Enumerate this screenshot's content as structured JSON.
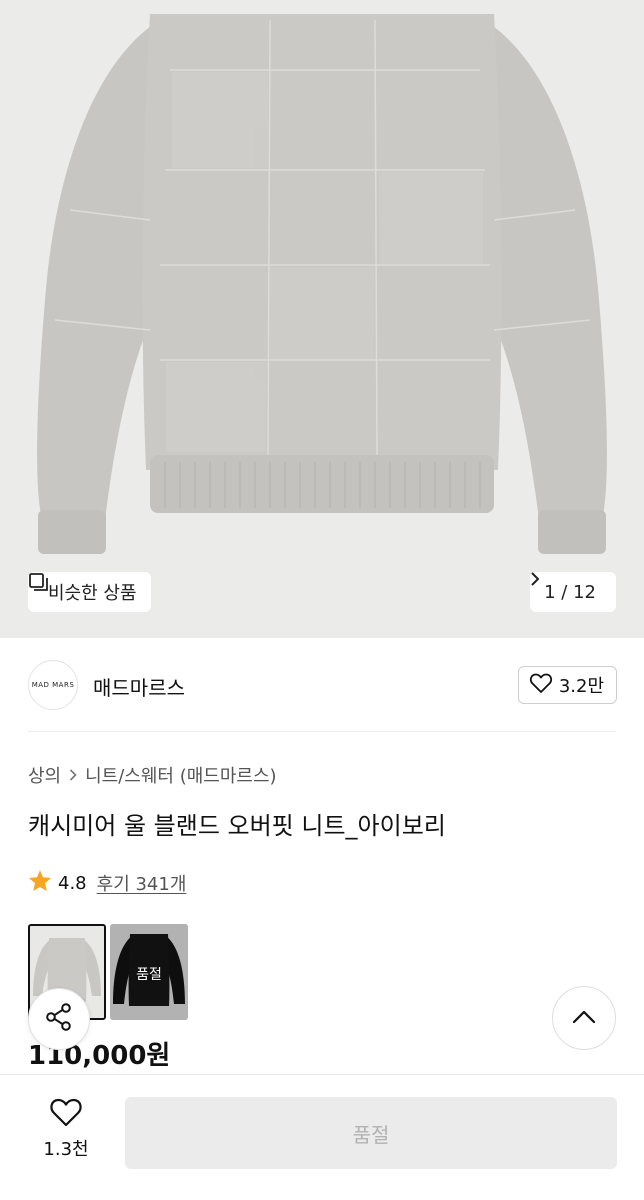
{
  "gallery": {
    "similar_label": "비슷한 상품",
    "counter": "1 / 12"
  },
  "brand": {
    "logo_text": "MAD  MARS",
    "name": "매드마르스",
    "likes": "3.2만"
  },
  "breadcrumb": {
    "category": "상의",
    "subcategory": "니트/스웨터 (매드마르스)"
  },
  "product": {
    "title": "캐시미어 울 블랜드 오버핏 니트_아이보리",
    "rating": "4.8",
    "reviews": "후기 341개",
    "price": "110,000원"
  },
  "swatches": [
    {
      "color": "ivory"
    },
    {
      "color": "black",
      "label": "품절"
    }
  ],
  "bottom_bar": {
    "wish_count": "1.3천",
    "buy_label": "품절"
  },
  "colors": {
    "star": "#f5a623",
    "sweater_ivory": "#c9c7c3",
    "sweater_black": "#121212",
    "disabled_button": "#ebebeb"
  },
  "icons": {
    "similar": "similar-products-icon",
    "next": "chevron-right-icon",
    "like": "heart-icon",
    "breadcrumb_separator": "chevron-right-icon",
    "rating": "star-icon",
    "share": "share-icon",
    "scroll_top": "chevron-up-icon",
    "wish": "heart-icon"
  }
}
